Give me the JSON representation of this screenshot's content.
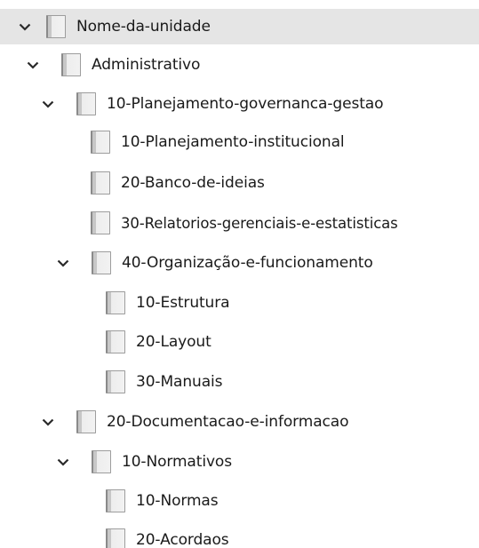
{
  "tree": {
    "root": {
      "label": "Nome-da-unidade",
      "expanded": true,
      "selected": true
    },
    "administrativo": {
      "label": "Administrativo",
      "expanded": true
    },
    "planejamento": {
      "label": "10-Planejamento-governanca-gestao",
      "expanded": true
    },
    "planejamento_institucional": {
      "label": "10-Planejamento-institucional"
    },
    "banco_ideias": {
      "label": "20-Banco-de-ideias"
    },
    "relatorios": {
      "label": "30-Relatorios-gerenciais-e-estatisticas"
    },
    "organizacao": {
      "label": "40-Organização-e-funcionamento",
      "expanded": true
    },
    "estrutura": {
      "label": "10-Estrutura"
    },
    "layout": {
      "label": "20-Layout"
    },
    "manuais": {
      "label": "30-Manuais"
    },
    "documentacao": {
      "label": "20-Documentacao-e-informacao",
      "expanded": true
    },
    "normativos": {
      "label": "10-Normativos",
      "expanded": true
    },
    "normas": {
      "label": "10-Normas"
    },
    "acordaos": {
      "label": "20-Acordaos"
    }
  },
  "icons": {
    "expand": "chevron-down-icon",
    "item": "folder-icon"
  },
  "colors": {
    "selected_background": "#e5e5e5",
    "text": "#1a1a1a"
  }
}
